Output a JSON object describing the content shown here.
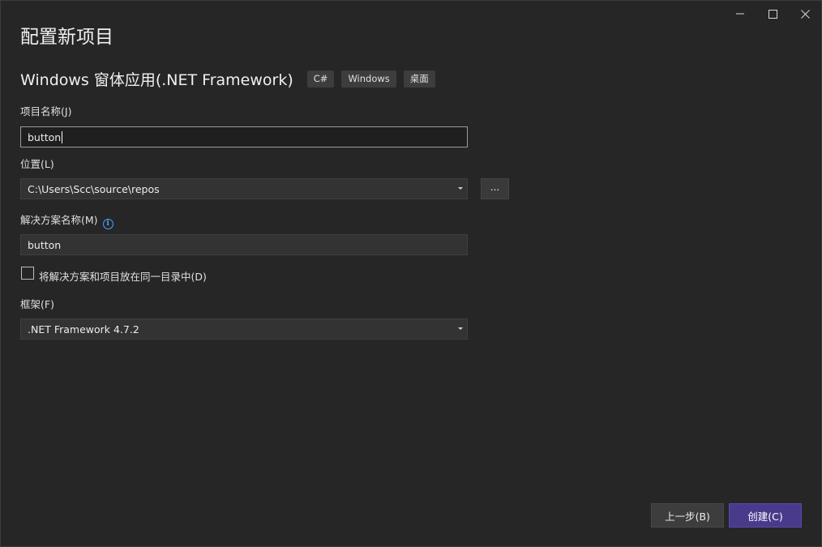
{
  "window": {
    "minimize_icon": "minimize-icon",
    "maximize_icon": "maximize-icon",
    "close_icon": "close-icon"
  },
  "page": {
    "title": "配置新项目"
  },
  "template": {
    "name": "Windows 窗体应用(.NET Framework)",
    "tags": [
      "C#",
      "Windows",
      "桌面"
    ]
  },
  "project_name": {
    "label": "项目名称(J)",
    "value": "button"
  },
  "location": {
    "label": "位置(L)",
    "value": "C:\\Users\\Scc\\source\\repos",
    "browse_label": "..."
  },
  "solution_name": {
    "label": "解决方案名称(M)",
    "info_icon": "info-icon",
    "value": "button"
  },
  "same_directory": {
    "label": "将解决方案和项目放在同一目录中(D)",
    "checked": false
  },
  "framework": {
    "label": "框架(F)",
    "value": ".NET Framework 4.7.2"
  },
  "footer": {
    "back_label": "上一步(B)",
    "create_label": "创建(C)"
  },
  "colors": {
    "background": "#262626",
    "input_background": "#333333",
    "primary_button": "#4a3a8c",
    "info_accent": "#4aa3ff"
  }
}
